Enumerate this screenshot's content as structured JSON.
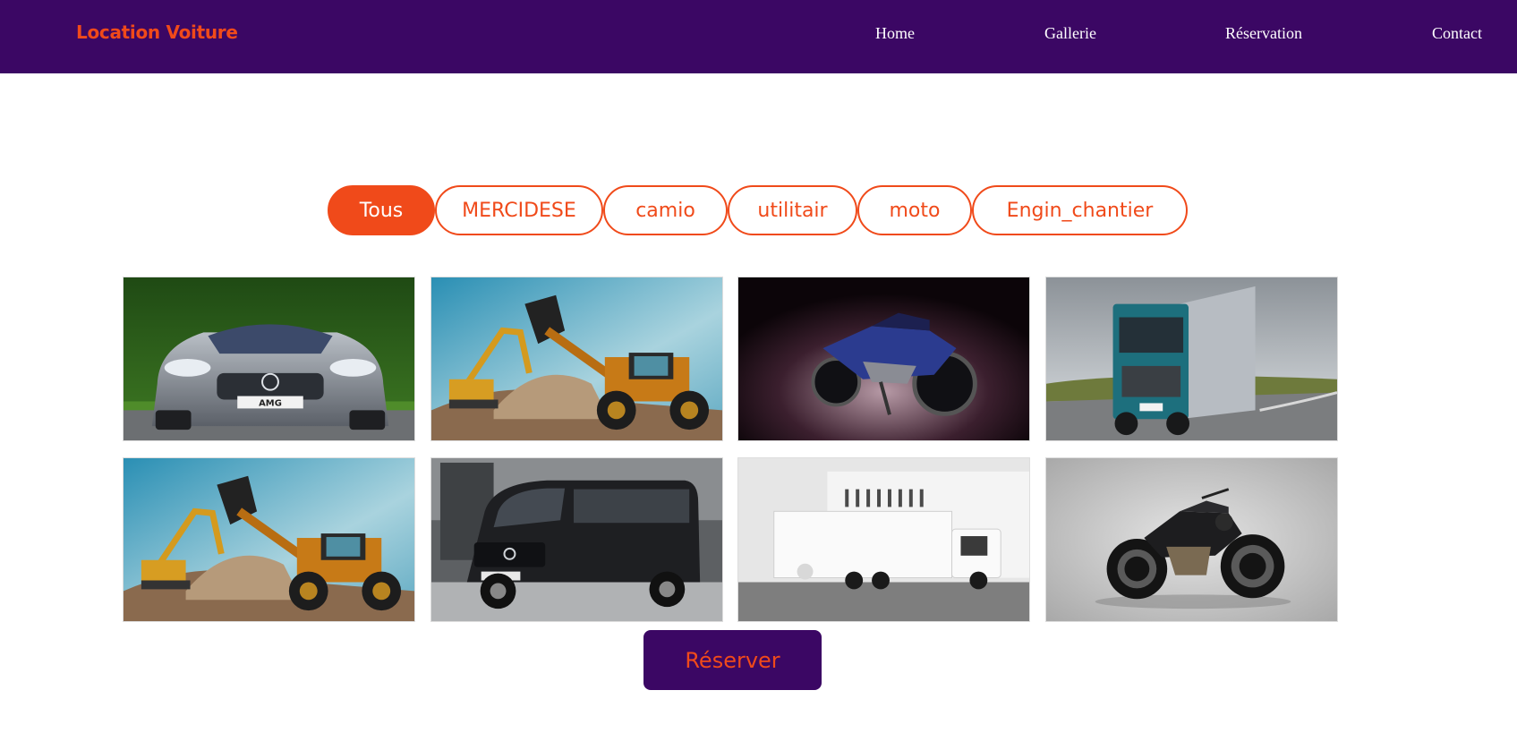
{
  "brand": {
    "name": "Location Voiture"
  },
  "nav": {
    "home": "Home",
    "gallery": "Gallerie",
    "reservation": "Réservation",
    "contact": "Contact"
  },
  "filters": {
    "all": "Tous",
    "mercedes": "MERCIDESE",
    "truck": "camio",
    "utility": "utilitair",
    "moto": "moto",
    "construction": "Engin_chantier",
    "selected": "Tous"
  },
  "gallery": {
    "items": [
      {
        "photo": "mercedes-amg-gt-coupe-photo",
        "category": "MERCIDESE",
        "plate_text": "AMG"
      },
      {
        "photo": "wheel-loader-and-excavator-photo",
        "category": "Engin_chantier"
      },
      {
        "photo": "sport-motorcycle-dark-photo",
        "category": "moto"
      },
      {
        "photo": "teal-semi-truck-photo",
        "category": "camio"
      },
      {
        "photo": "wheel-loader-and-excavator-photo",
        "category": "Engin_chantier"
      },
      {
        "photo": "black-mercedes-van-photo",
        "category": "utilitair"
      },
      {
        "photo": "white-box-truck-photo",
        "category": "camio"
      },
      {
        "photo": "naked-motorcycle-photo",
        "category": "moto"
      }
    ]
  },
  "actions": {
    "reserve": "Réserver"
  },
  "colors": {
    "primary_purple": "#3b0764",
    "accent_orange": "#f04a1a",
    "nav_text": "#ffffff",
    "background": "#ffffff"
  }
}
